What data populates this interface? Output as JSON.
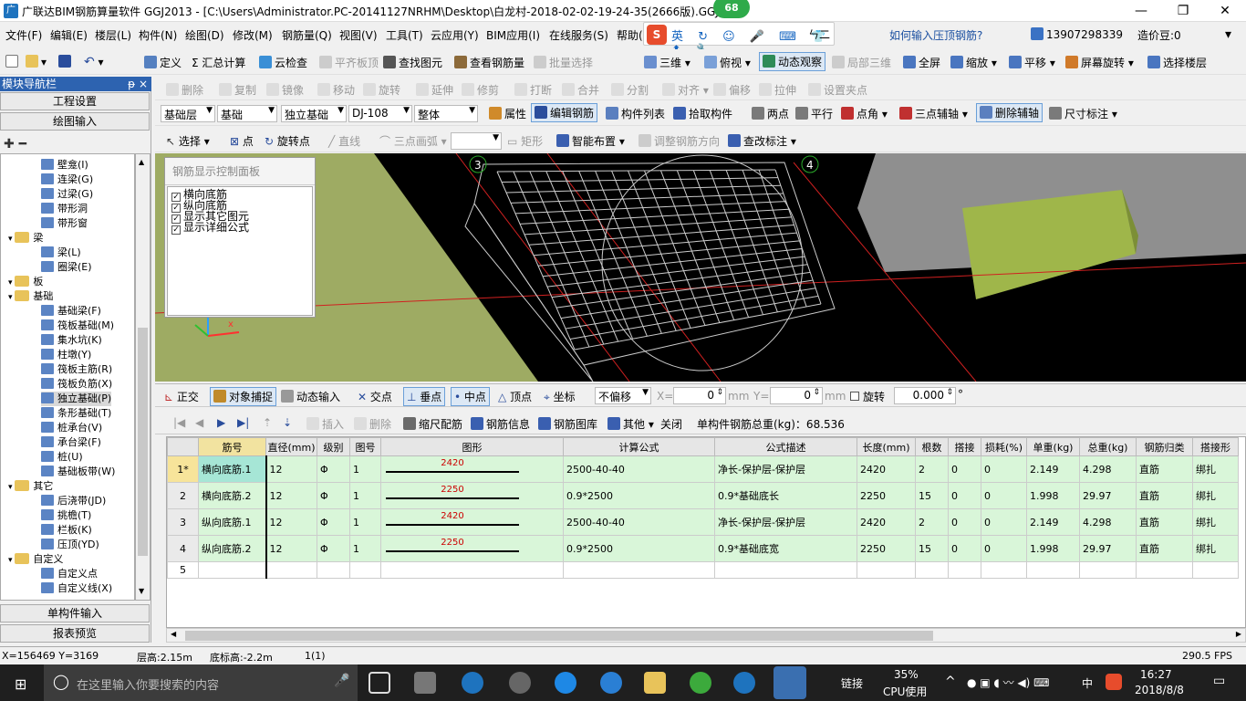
{
  "window": {
    "title": "广联达BIM钢筋算量软件 GGJ2013 - [C:\\Users\\Administrator.PC-20141127NRHM\\Desktop\\白龙村-2018-02-02-19-24-35(2666版).GGJ12",
    "badge": "68",
    "min": "—",
    "max": "❐",
    "close": "✕"
  },
  "menu": [
    "文件(F)",
    "编辑(E)",
    "楼层(L)",
    "构件(N)",
    "绘图(D)",
    "修改(M)",
    "钢筋量(Q)",
    "视图(V)",
    "工具(T)",
    "云应用(Y)",
    "BIM应用(I)",
    "在线服务(S)",
    "帮助(H)"
  ],
  "ime": {
    "logo": "S",
    "glyphs": "英 ↻ ☺ 🎤 ⌨ 👕 ⬆ 🔧",
    "tail": "ㄣ二"
  },
  "header_right": {
    "question": "如何输入压顶钢筋?",
    "phone": "13907298339",
    "bean": "造价豆:0"
  },
  "toolbar1": {
    "items": [
      "定义",
      "Σ 汇总计算",
      "云检查",
      "平齐板顶",
      "查找图元",
      "查看钢筋量",
      "批量选择",
      "三维",
      "俯视",
      "动态观察",
      "局部三维",
      "全屏",
      "缩放",
      "平移",
      "屏幕旋转",
      "选择楼层"
    ]
  },
  "toolbar2": {
    "items": [
      "删除",
      "复制",
      "镜像",
      "移动",
      "旋转",
      "延伸",
      "修剪",
      "打断",
      "合并",
      "分割",
      "对齐",
      "偏移",
      "拉伸",
      "设置夹点"
    ]
  },
  "toolbar3": {
    "floor": "基础层",
    "category": "基础",
    "type": "独立基础",
    "element": "DJ-108",
    "part": "整体",
    "items": [
      "属性",
      "编辑钢筋",
      "构件列表",
      "拾取构件",
      "两点",
      "平行",
      "点角",
      "三点辅轴",
      "删除辅轴",
      "尺寸标注"
    ]
  },
  "toolbar4": {
    "items": [
      "选择",
      "点",
      "旋转点",
      "直线",
      "三点画弧",
      "矩形",
      "智能布置",
      "调整钢筋方向",
      "查改标注"
    ]
  },
  "leftpanel": {
    "header": "模块导航栏",
    "pin": "ᵽ ×",
    "btn1": "工程设置",
    "btn2": "绘图输入",
    "btn3": "单构件输入",
    "btn4": "报表预览",
    "tree": [
      {
        "label": "壁龛(I)",
        "level": 2,
        "folder": false
      },
      {
        "label": "连梁(G)",
        "level": 2,
        "folder": false
      },
      {
        "label": "过梁(G)",
        "level": 2,
        "folder": false
      },
      {
        "label": "带形洞",
        "level": 2,
        "folder": false
      },
      {
        "label": "带形窗",
        "level": 2,
        "folder": false
      },
      {
        "label": "梁",
        "level": 1,
        "folder": true
      },
      {
        "label": "梁(L)",
        "level": 2,
        "folder": false
      },
      {
        "label": "圈梁(E)",
        "level": 2,
        "folder": false
      },
      {
        "label": "板",
        "level": 1,
        "folder": true
      },
      {
        "label": "基础",
        "level": 1,
        "folder": true
      },
      {
        "label": "基础梁(F)",
        "level": 2,
        "folder": false
      },
      {
        "label": "筏板基础(M)",
        "level": 2,
        "folder": false
      },
      {
        "label": "集水坑(K)",
        "level": 2,
        "folder": false
      },
      {
        "label": "柱墩(Y)",
        "level": 2,
        "folder": false
      },
      {
        "label": "筏板主筋(R)",
        "level": 2,
        "folder": false
      },
      {
        "label": "筏板负筋(X)",
        "level": 2,
        "folder": false
      },
      {
        "label": "独立基础(P)",
        "level": 2,
        "folder": false,
        "selected": true
      },
      {
        "label": "条形基础(T)",
        "level": 2,
        "folder": false
      },
      {
        "label": "桩承台(V)",
        "level": 2,
        "folder": false
      },
      {
        "label": "承台梁(F)",
        "level": 2,
        "folder": false
      },
      {
        "label": "桩(U)",
        "level": 2,
        "folder": false
      },
      {
        "label": "基础板带(W)",
        "level": 2,
        "folder": false
      },
      {
        "label": "其它",
        "level": 1,
        "folder": true
      },
      {
        "label": "后浇带(JD)",
        "level": 2,
        "folder": false
      },
      {
        "label": "挑檐(T)",
        "level": 2,
        "folder": false
      },
      {
        "label": "栏板(K)",
        "level": 2,
        "folder": false
      },
      {
        "label": "压顶(YD)",
        "level": 2,
        "folder": false
      },
      {
        "label": "自定义",
        "level": 1,
        "folder": true
      },
      {
        "label": "自定义点",
        "level": 2,
        "folder": false
      },
      {
        "label": "自定义线(X)",
        "level": 2,
        "folder": false
      }
    ]
  },
  "viewport": {
    "panel_title": "钢筋显示控制面板",
    "options": [
      "横向底筋",
      "纵向底筋",
      "显示其它图元",
      "显示详细公式"
    ],
    "axis3": "3",
    "axis4": "4"
  },
  "snapbar": {
    "items": [
      "正交",
      "对象捕捉",
      "动态输入",
      "交点",
      "垂点",
      "中点",
      "顶点",
      "坐标",
      "不偏移"
    ],
    "x_label": "X=",
    "x_val": "0",
    "unit1": "mm",
    "y_label": "Y=",
    "y_val": "0",
    "unit2": "mm",
    "rotate": "旋转",
    "rot_val": "0.000",
    "deg": "°"
  },
  "rebarbar": {
    "items": [
      "插入",
      "删除",
      "缩尺配筋",
      "钢筋信息",
      "钢筋图库",
      "其他",
      "关闭"
    ],
    "total": "单构件钢筋总重(kg)：68.536"
  },
  "table": {
    "headers": [
      "",
      "筋号",
      "直径(mm)",
      "级别",
      "图号",
      "图形",
      "计算公式",
      "公式描述",
      "长度(mm)",
      "根数",
      "搭接",
      "损耗(%)",
      "单重(kg)",
      "总重(kg)",
      "钢筋归类",
      "搭接形"
    ],
    "rows": [
      {
        "no": "1*",
        "name": "横向底筋.1",
        "dia": "12",
        "grade": "Φ",
        "fig": "1",
        "shape": "2420",
        "formula": "2500-40-40",
        "desc": "净长-保护层-保护层",
        "len": "2420",
        "count": "2",
        "lap": "0",
        "loss": "0",
        "unit": "2.149",
        "total": "4.298",
        "cls": "直筋",
        "laptype": "绑扎"
      },
      {
        "no": "2",
        "name": "横向底筋.2",
        "dia": "12",
        "grade": "Φ",
        "fig": "1",
        "shape": "2250",
        "formula": "0.9*2500",
        "desc": "0.9*基础底长",
        "len": "2250",
        "count": "15",
        "lap": "0",
        "loss": "0",
        "unit": "1.998",
        "total": "29.97",
        "cls": "直筋",
        "laptype": "绑扎"
      },
      {
        "no": "3",
        "name": "纵向底筋.1",
        "dia": "12",
        "grade": "Φ",
        "fig": "1",
        "shape": "2420",
        "formula": "2500-40-40",
        "desc": "净长-保护层-保护层",
        "len": "2420",
        "count": "2",
        "lap": "0",
        "loss": "0",
        "unit": "2.149",
        "total": "4.298",
        "cls": "直筋",
        "laptype": "绑扎"
      },
      {
        "no": "4",
        "name": "纵向底筋.2",
        "dia": "12",
        "grade": "Φ",
        "fig": "1",
        "shape": "2250",
        "formula": "0.9*2500",
        "desc": "0.9*基础底宽",
        "len": "2250",
        "count": "15",
        "lap": "0",
        "loss": "0",
        "unit": "1.998",
        "total": "29.97",
        "cls": "直筋",
        "laptype": "绑扎"
      }
    ],
    "empty_row": "5"
  },
  "status": {
    "coords": "X=156469 Y=3169",
    "floor_height": "层高:2.15m",
    "base_height": "底标高:-2.2m",
    "count": "1(1)",
    "fps": "290.5 FPS"
  },
  "taskbar": {
    "search_placeholder": "在这里输入你要搜索的内容",
    "link": "链接",
    "cpu": "35%",
    "cpu_label": "CPU使用",
    "lang": "中",
    "time": "16:27",
    "date": "2018/8/8"
  }
}
